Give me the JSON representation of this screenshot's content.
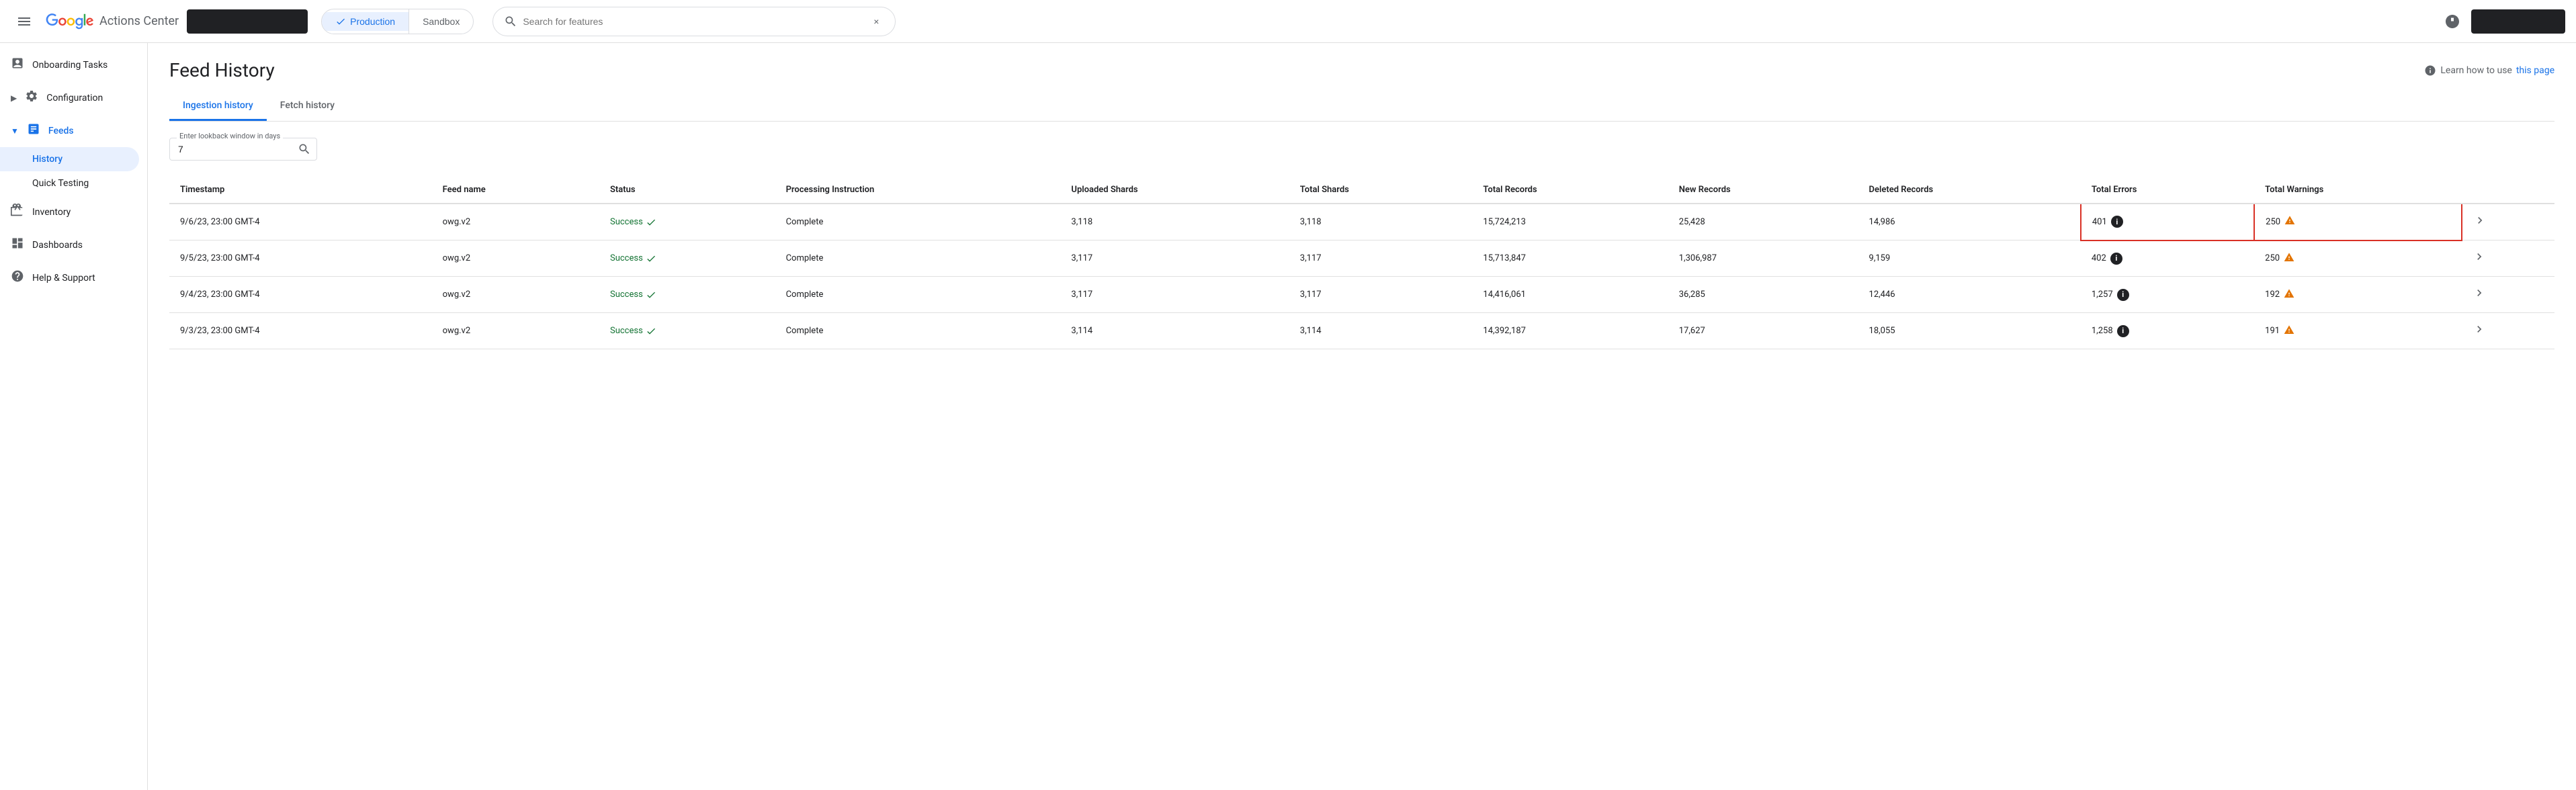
{
  "app": {
    "title": "Actions Center",
    "hamburger_label": "Menu"
  },
  "nav": {
    "env_options": [
      "Production",
      "Sandbox"
    ],
    "active_env": "Production",
    "search_placeholder": "Search for features",
    "search_value": "",
    "clear_label": "×"
  },
  "sidebar": {
    "items": [
      {
        "id": "onboarding",
        "label": "Onboarding Tasks",
        "icon": "📋",
        "type": "item"
      },
      {
        "id": "configuration",
        "label": "Configuration",
        "icon": "⚙️",
        "type": "expandable"
      },
      {
        "id": "feeds",
        "label": "Feeds",
        "icon": "📊",
        "type": "expandable",
        "expanded": true
      },
      {
        "id": "history",
        "label": "History",
        "type": "child",
        "active": true
      },
      {
        "id": "quick-testing",
        "label": "Quick Testing",
        "type": "child"
      },
      {
        "id": "inventory",
        "label": "Inventory",
        "icon": "🗂️",
        "type": "item"
      },
      {
        "id": "dashboards",
        "label": "Dashboards",
        "icon": "📈",
        "type": "item"
      },
      {
        "id": "help",
        "label": "Help & Support",
        "icon": "❓",
        "type": "item"
      }
    ]
  },
  "page": {
    "title": "Feed History",
    "help_text": "Learn how to use",
    "help_link_label": "this page"
  },
  "tabs": [
    {
      "id": "ingestion",
      "label": "Ingestion history",
      "active": true
    },
    {
      "id": "fetch",
      "label": "Fetch history",
      "active": false
    }
  ],
  "lookback": {
    "label": "Enter lookback window in days",
    "value": "7"
  },
  "table": {
    "columns": [
      "Timestamp",
      "Feed name",
      "Status",
      "Processing Instruction",
      "Uploaded Shards",
      "Total Shards",
      "Total Records",
      "New Records",
      "Deleted Records",
      "Total Errors",
      "Total Warnings",
      ""
    ],
    "rows": [
      {
        "timestamp": "9/6/23, 23:00 GMT-4",
        "feed_name": "owg.v2",
        "status": "Success",
        "processing_instruction": "Complete",
        "uploaded_shards": "3,118",
        "total_shards": "3,118",
        "total_records": "15,724,213",
        "new_records": "25,428",
        "deleted_records": "14,986",
        "total_errors": "401",
        "total_warnings": "250",
        "highlighted": true
      },
      {
        "timestamp": "9/5/23, 23:00 GMT-4",
        "feed_name": "owg.v2",
        "status": "Success",
        "processing_instruction": "Complete",
        "uploaded_shards": "3,117",
        "total_shards": "3,117",
        "total_records": "15,713,847",
        "new_records": "1,306,987",
        "deleted_records": "9,159",
        "total_errors": "402",
        "total_warnings": "250",
        "highlighted": false
      },
      {
        "timestamp": "9/4/23, 23:00 GMT-4",
        "feed_name": "owg.v2",
        "status": "Success",
        "processing_instruction": "Complete",
        "uploaded_shards": "3,117",
        "total_shards": "3,117",
        "total_records": "14,416,061",
        "new_records": "36,285",
        "deleted_records": "12,446",
        "total_errors": "1,257",
        "total_warnings": "192",
        "highlighted": false
      },
      {
        "timestamp": "9/3/23, 23:00 GMT-4",
        "feed_name": "owg.v2",
        "status": "Success",
        "processing_instruction": "Complete",
        "uploaded_shards": "3,114",
        "total_shards": "3,114",
        "total_records": "14,392,187",
        "new_records": "17,627",
        "deleted_records": "18,055",
        "total_errors": "1,258",
        "total_warnings": "191",
        "highlighted": false
      }
    ]
  }
}
